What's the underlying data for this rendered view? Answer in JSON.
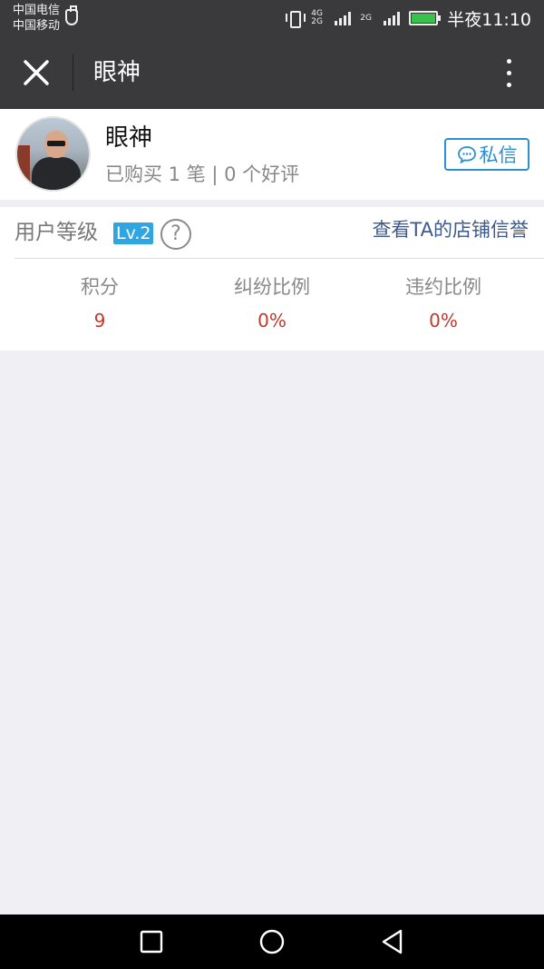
{
  "status_bar": {
    "carrier_1": "中国电信",
    "carrier_2": "中国移动",
    "network_1": "4G 2G",
    "network_2": "2G",
    "time": "半夜11:10",
    "icons": [
      "usb-icon",
      "vibrate-icon",
      "signal-icon",
      "battery-icon"
    ]
  },
  "navbar": {
    "title": "眼神",
    "close_icon": "close-icon",
    "more_icon": "more-vertical-icon"
  },
  "profile": {
    "name": "眼神",
    "stats": "已购买 1 笔 | 0 个好评",
    "message_button": "私信",
    "message_icon": "chat-bubble-icon"
  },
  "level": {
    "label": "用户等级",
    "badge": "Lv.2",
    "help_icon": "?",
    "store_link": "查看TA的店铺信誉",
    "metrics": [
      {
        "label": "积分",
        "value": "9"
      },
      {
        "label": "纠纷比例",
        "value": "0%"
      },
      {
        "label": "违约比例",
        "value": "0%"
      }
    ]
  },
  "colors": {
    "header_bg": "#3a3a3c",
    "page_bg": "#efeff4",
    "accent_blue": "#2b8fd1",
    "badge_blue": "#2fa6e2",
    "value_red": "#c0392b",
    "link_blue": "#3d5a8a"
  }
}
